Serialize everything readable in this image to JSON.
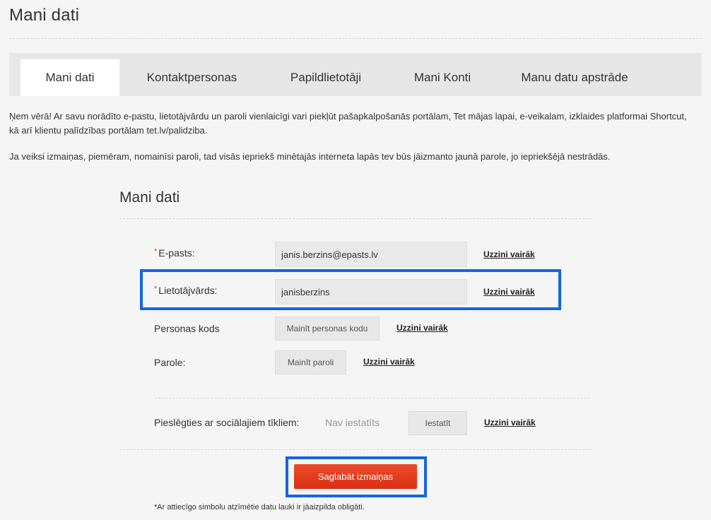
{
  "page": {
    "title": "Mani dati"
  },
  "tabs": [
    {
      "label": "Mani dati",
      "active": true
    },
    {
      "label": "Kontaktpersonas",
      "active": false
    },
    {
      "label": "Papildlietotāji",
      "active": false
    },
    {
      "label": "Mani Konti",
      "active": false
    },
    {
      "label": "Manu datu apstrāde",
      "active": false
    }
  ],
  "notice": {
    "line1": "Ņem vērā! Ar savu norādīto e-pastu, lietotājvārdu un paroli vienlaicīgi vari piekļūt pašapkalpošanās portālam, Tet mājas lapai, e-veikalam, izklaides platformai Shortcut, kā arī klientu palīdzības portālam tet.lv/palidziba.",
    "line2": "Ja veiksi izmaiņas, piemēram, nomainīsi paroli, tad visās iepriekš minētajās interneta lapās tev būs jāizmanto jaunā parole, jo iepriekšējā nestrādās."
  },
  "form": {
    "title": "Mani dati",
    "required_mark": "*",
    "email": {
      "label": "E-pasts:",
      "value": "janis.berzins@epasts.lv",
      "more": "Uzzini vairāk"
    },
    "username": {
      "label": "Lietotājvārds:",
      "value": "janisberzins",
      "more": "Uzzini vairāk"
    },
    "personal_code": {
      "label": "Personas kods",
      "button": "Mainīt personas kodu",
      "more": "Uzzini vairāk"
    },
    "password": {
      "label": "Parole:",
      "button": "Mainīt paroli",
      "more": "Uzzini vairāk"
    },
    "social": {
      "label": "Pieslēgties ar sociālajiem tīkliem:",
      "status": "Nav iestatīts",
      "button": "Iestatīt",
      "more": "Uzzini vairāk"
    },
    "save_button": "Saglabāt izmaiņas",
    "footnote": "*Ar attiecīgo simbolu atzīmētie datu lauki ir jāaizpilda obligāti."
  },
  "colors": {
    "accent": "#e4391c",
    "highlight": "#1565e6",
    "tab_bar": "#e7e7e7",
    "background": "#f5f5f5"
  }
}
